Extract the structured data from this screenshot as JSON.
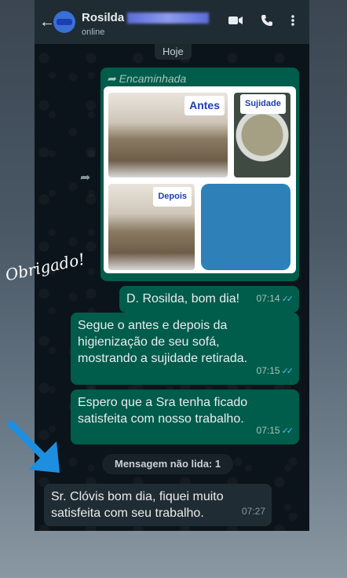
{
  "header": {
    "back_icon": "arrow-left-icon",
    "contact_name": "Rosilda",
    "status": "online",
    "actions": [
      "video-call-icon",
      "phone-icon",
      "more-vert-icon"
    ]
  },
  "chat": {
    "date_label": "Hoje",
    "forwarded_label": "Encaminhada",
    "images": {
      "before_label": "Antes",
      "dirt_label": "Sujidade",
      "after_label": "Depois"
    },
    "messages_out": [
      {
        "text": "D. Rosilda, bom dia!",
        "time": "07:14"
      },
      {
        "text": "Segue o antes e depois da higienização de seu sofá, mostrando a sujidade retirada.",
        "time": "07:15"
      },
      {
        "text": "Espero que a Sra tenha ficado satisfeita com nosso trabalho.",
        "time": "07:15"
      }
    ],
    "unread_label": "Mensagem não lida: 1",
    "message_in": {
      "text": "Sr. Clóvis bom dia, fiquei muito satisfeita com seu trabalho.",
      "time": "07:27"
    }
  },
  "overlay": {
    "handwritten": "Obrigado!"
  },
  "colors": {
    "outgoing_bubble": "#005c4b",
    "incoming_bubble": "#202c33",
    "read_ticks": "#53bdeb",
    "arrow": "#1e8fe0"
  }
}
